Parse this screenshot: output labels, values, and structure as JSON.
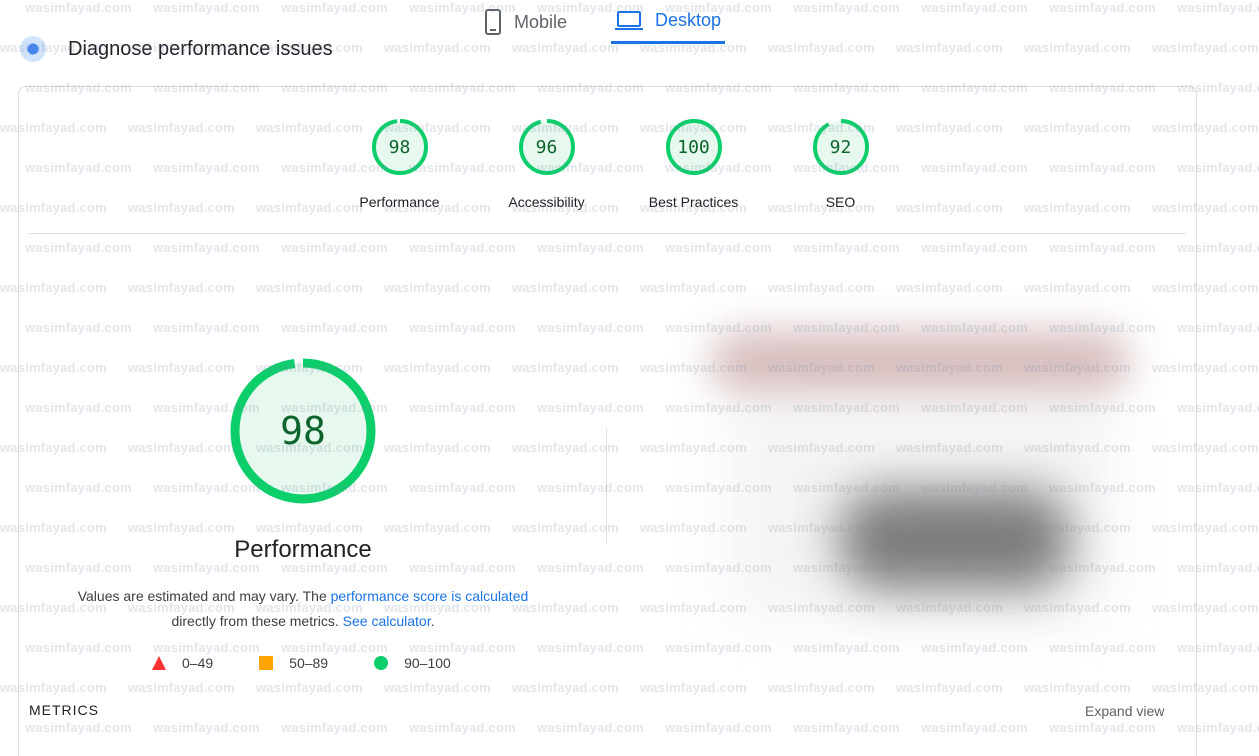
{
  "tabs": [
    {
      "label": "Mobile",
      "icon": "phone-icon",
      "active": false
    },
    {
      "label": "Desktop",
      "icon": "laptop-icon",
      "active": true
    }
  ],
  "header": {
    "title": "Diagnose performance issues"
  },
  "categories": [
    {
      "score": "98",
      "label": "Performance",
      "value": 0.98
    },
    {
      "score": "96",
      "label": "Accessibility",
      "value": 0.96
    },
    {
      "score": "100",
      "label": "Best Practices",
      "value": 1.0
    },
    {
      "score": "92",
      "label": "SEO",
      "value": 0.92
    }
  ],
  "main": {
    "score": "98",
    "score_value": 0.98,
    "title": "Performance",
    "explain_prefix": "Values are estimated and may vary. The ",
    "explain_link": "performance score is calculated",
    "explain_mid": "directly from these metrics. ",
    "explain_link2": "See calculator",
    "explain_end": "."
  },
  "legend": [
    {
      "shape": "triangle",
      "range": "0–49",
      "color": "#ff3333"
    },
    {
      "shape": "square",
      "range": "50–89",
      "color": "#ffa400"
    },
    {
      "shape": "circle",
      "range": "90–100",
      "color": "#0cce6b"
    }
  ],
  "footer": {
    "metrics_label": "METRICS",
    "expand_label": "Expand view"
  },
  "watermark": "wasimfayad.com",
  "colors": {
    "accent": "#1a73e8",
    "pass": "#0cce6b",
    "pass_text": "#0d652d"
  }
}
